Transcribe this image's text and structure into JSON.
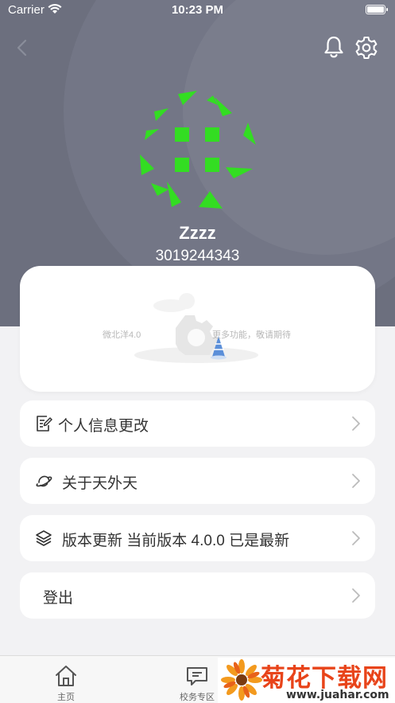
{
  "status_bar": {
    "carrier": "Carrier",
    "time": "10:23 PM"
  },
  "header": {
    "background_color": "#6c6f7e",
    "username": "Zzzz",
    "user_id": "3019244343"
  },
  "feature_card": {
    "left_text": "微北洋4.0",
    "right_text": "更多功能，敬请期待"
  },
  "menu": [
    {
      "label": "个人信息更改",
      "icon": "edit-document-icon"
    },
    {
      "label": "关于天外天",
      "icon": "planet-icon"
    },
    {
      "label": "版本更新 当前版本 4.0.0 已是最新",
      "icon": "layers-icon"
    },
    {
      "label": "登出",
      "icon": ""
    }
  ],
  "tabbar": {
    "tabs": [
      {
        "label": "主页",
        "icon": "home-icon"
      },
      {
        "label": "校务专区",
        "icon": "message-icon"
      }
    ]
  },
  "watermark": {
    "title": "菊花下载网",
    "url": "www.juahar.com"
  },
  "colors": {
    "avatar_green": "#33dd22",
    "accent_orange": "#e8441a"
  }
}
